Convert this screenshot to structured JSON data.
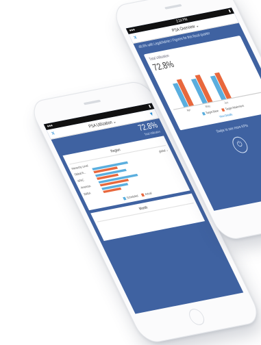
{
  "phone_a": {
    "status_time": "2:24 PM",
    "nav_title": "PSA Overview ⌄",
    "banner": "48.6% with Legal/Admin / Figures for this fiscal quarter",
    "card": {
      "total_label": "Total Utilization",
      "total_value": "72.8%"
    },
    "chart_data": {
      "type": "bar",
      "categories": [
        "Apr",
        "May",
        "Jun"
      ],
      "series": [
        {
          "name": "Target Base",
          "values": [
            70,
            72,
            70
          ]
        },
        {
          "name": "Target Attainment",
          "values": [
            78,
            80,
            76
          ]
        }
      ],
      "ylim": [
        0,
        100
      ]
    },
    "legend": [
      "Target Base",
      "Target Attainment"
    ],
    "link": "View Details",
    "swipe": "Swipe to see more KPIs"
  },
  "phone_b": {
    "nav_title": "PSA Utilization ⌄",
    "big_value": "72.8%",
    "sub": "Total Utilization",
    "region_title": "Region",
    "hier_label": "Hierarchy Level",
    "hier_value": "global ⌄",
    "rows": [
      {
        "label": "Global R...",
        "v1": 60,
        "v2": 40
      },
      {
        "label": "APAC",
        "v1": 52,
        "v2": 36
      },
      {
        "label": "Americas",
        "v1": 66,
        "v2": 48
      },
      {
        "label": "EMEA",
        "v1": 44,
        "v2": 30
      }
    ],
    "legend": [
      "Scheduled",
      "Actual"
    ],
    "month_title": "Month",
    "colors": {
      "blue": "#3f62a1",
      "series1": "#5aaede",
      "series2": "#e8683d"
    }
  }
}
